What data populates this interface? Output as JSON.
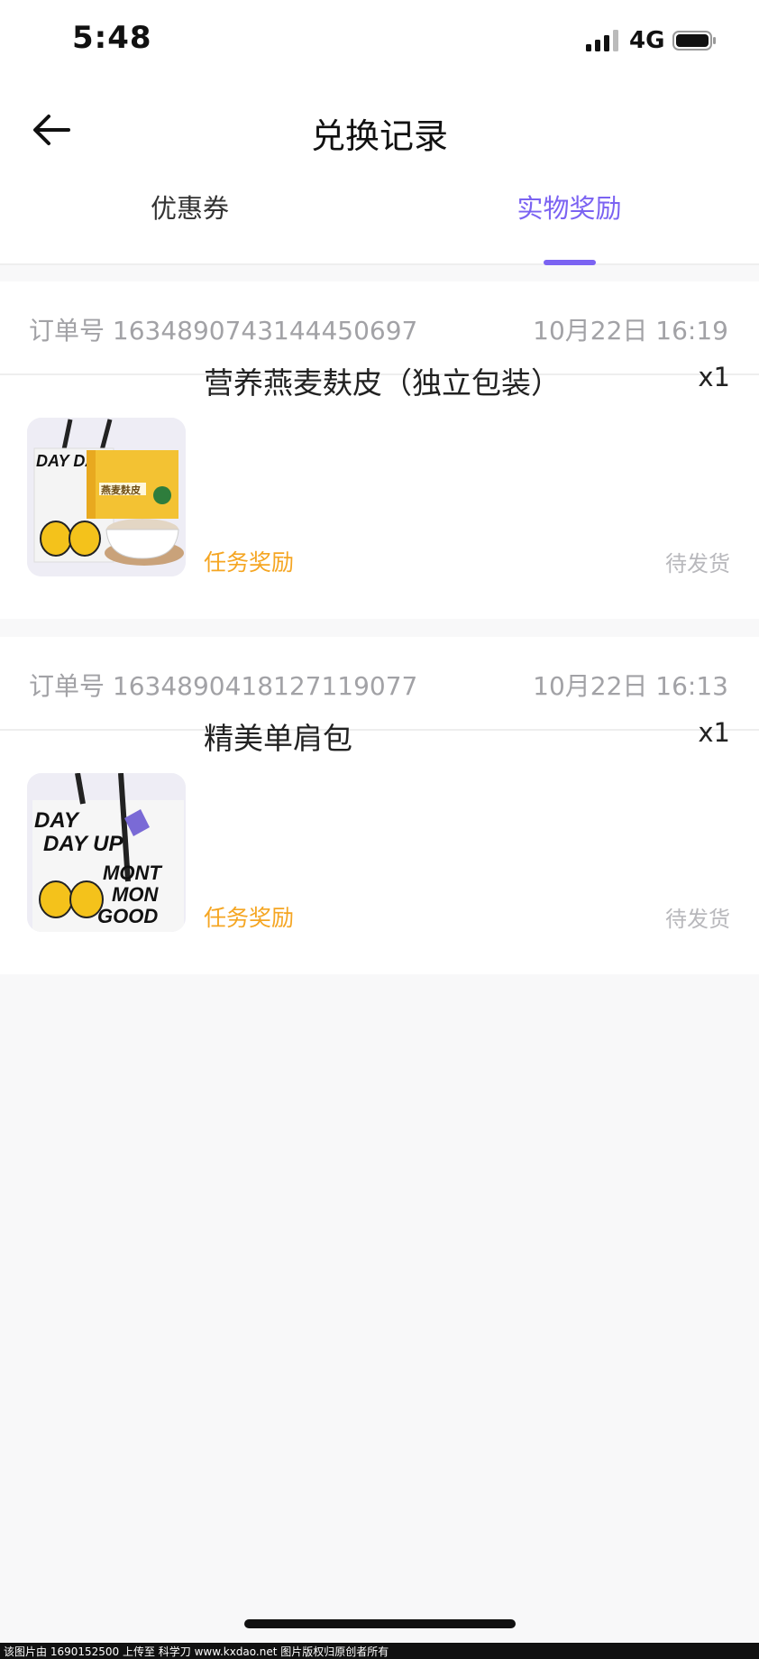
{
  "status_bar": {
    "time": "5:48",
    "network": "4G"
  },
  "header": {
    "title": "兑换记录"
  },
  "tabs": [
    {
      "label": "优惠券",
      "active": false
    },
    {
      "label": "实物奖励",
      "active": true
    }
  ],
  "orders": [
    {
      "order_no": "订单号 1634890743144450697",
      "time": "10月22日 16:19",
      "product_name": "营养燕麦麸皮（独立包装）",
      "quantity": "x1",
      "tag": "任务奖励",
      "status": "待发货",
      "thumb": {
        "bag_text": "DAY DAY",
        "box_text": "燕麦麸皮"
      }
    },
    {
      "order_no": "订单号 1634890418127119077",
      "time": "10月22日 16:13",
      "product_name": "精美单肩包",
      "quantity": "x1",
      "tag": "任务奖励",
      "status": "待发货",
      "thumb": {
        "bag_line1": "DAY",
        "bag_line2": "DAY UP",
        "bag_line3": "MONT",
        "bag_line4": "MON",
        "bag_line5": "GOOD"
      }
    }
  ],
  "footer": {
    "text": "该图片由 1690152500 上传至 科学刀 www.kxdao.net 图片版权归原创者所有"
  },
  "colors": {
    "accent": "#7b63f2",
    "tag": "#f5a623",
    "muted": "#a2a2a6"
  }
}
